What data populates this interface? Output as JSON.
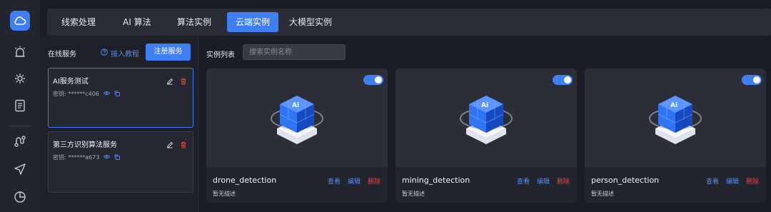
{
  "tabs": [
    "线索处理",
    "AI 算法",
    "算法实例",
    "云端实例",
    "大模型实例"
  ],
  "active_tab": "云端实例",
  "left_panel": {
    "title": "在线服务",
    "guide_label": "接入教程",
    "register_label": "注册服务",
    "services": [
      {
        "name": "AI服务测试",
        "key": "密钥: ******c406"
      },
      {
        "name": "第三方识别算法服务",
        "key": "密钥: ******a673"
      }
    ]
  },
  "instances": {
    "title": "实例列表",
    "search_placeholder": "搜索实例名称",
    "items": [
      {
        "name": "drone_detection",
        "desc": "暂无描述",
        "enabled": true
      },
      {
        "name": "mining_detection",
        "desc": "暂无描述",
        "enabled": true
      },
      {
        "name": "person_detection",
        "desc": "暂无描述",
        "enabled": true
      }
    ],
    "view_label": "查看",
    "edit_label": "编辑",
    "delete_label": "删除"
  },
  "colors": {
    "accent": "#3f7ef3",
    "danger": "#e54545",
    "background": "#1b1d26"
  },
  "icons": {
    "sidebar": [
      "logo-cloud-icon",
      "alarm-icon",
      "settings-icon",
      "report-icon",
      "route-icon",
      "send-icon",
      "chart-icon"
    ]
  }
}
